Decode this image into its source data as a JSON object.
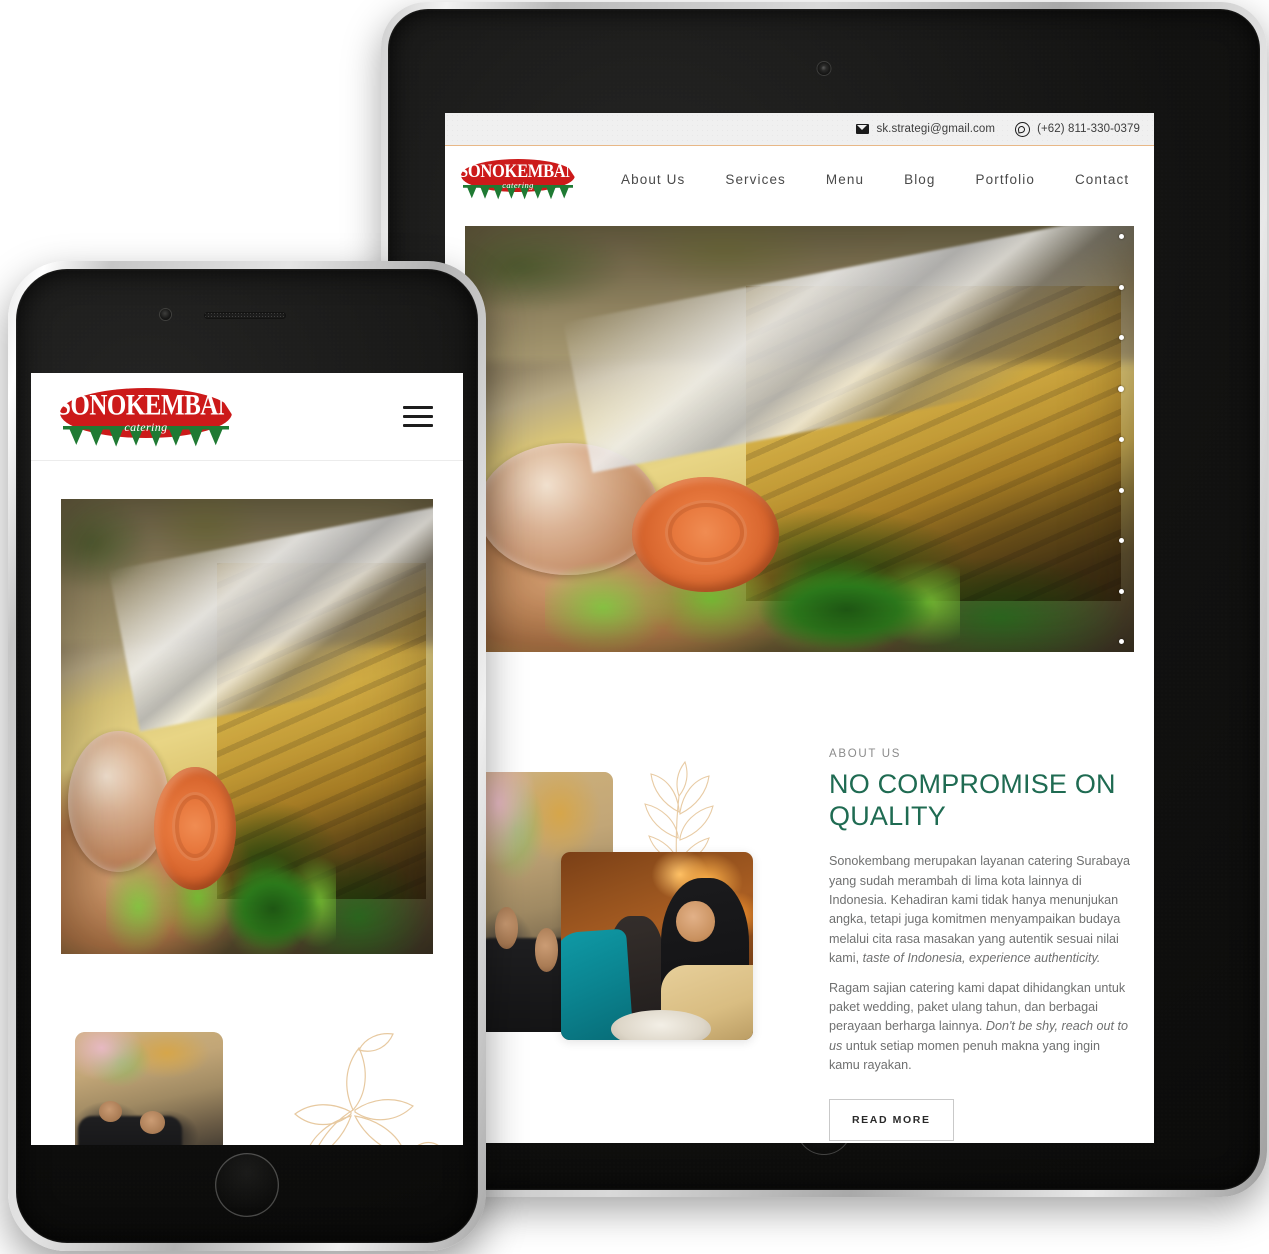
{
  "site": {
    "brand": {
      "name": "SONOKEMBANG",
      "tagline": "catering",
      "oval_color": "#cc1a1a",
      "leaf_color": "#1f7a33"
    },
    "topbar": {
      "email": "sk.strategi@gmail.com",
      "phone": "(+62) 811-330-0379",
      "mail_icon": "envelope-icon",
      "phone_icon": "whatsapp-icon",
      "background": "#f0f0f0",
      "accent_border": "#e8b887"
    },
    "nav": {
      "items": [
        {
          "label": "About Us"
        },
        {
          "label": "Services"
        },
        {
          "label": "Menu"
        },
        {
          "label": "Blog"
        },
        {
          "label": "Portfolio"
        },
        {
          "label": "Contact"
        }
      ],
      "mobile_menu_icon": "hamburger-menu-icon"
    },
    "hero": {
      "alt": "Catering tray of cheese-topped salmon with lettuce, parsley, carrot rose garnish and a cup of sauce",
      "slider_dots": 9,
      "active_dot_index": 3
    },
    "about": {
      "eyebrow": "ABOUT US",
      "heading": "NO COMPROMISE ON QUALITY",
      "heading_color": "#1f6b52",
      "paragraph_1_a": "Sonokembang merupakan layanan catering Surabaya yang sudah merambah di lima kota lainnya di Indonesia. Kehadiran kami tidak hanya menunjukan angka, tetapi juga komitmen menyampaikan budaya melalui cita rasa masakan yang autentik sesuai nilai kami, ",
      "paragraph_1_em": "taste of Indonesia, experience authenticity.",
      "paragraph_2_a": "Ragam sajian catering kami dapat dihidangkan untuk paket wedding, paket ulang tahun, dan berbagai perayaan berharga lainnya. ",
      "paragraph_2_em": "Don't be shy, reach out to us",
      "paragraph_2_b": " untuk setiap momen penuh makna yang ingin kamu rayakan.",
      "cta_label": "READ MORE",
      "photo_1_alt": "Guests in black batik attire at a wedding reception with floral decor",
      "photo_2_alt": "Smiling catering staff in hijab serving food to a guest",
      "decor": "botanical-line-art"
    }
  },
  "devices": {
    "tablet": {
      "name": "tablet-device",
      "camera": "front-camera",
      "home": "home-button"
    },
    "phone": {
      "name": "phone-device",
      "camera": "front-camera",
      "speaker": "earpiece-speaker",
      "home": "home-button"
    }
  }
}
